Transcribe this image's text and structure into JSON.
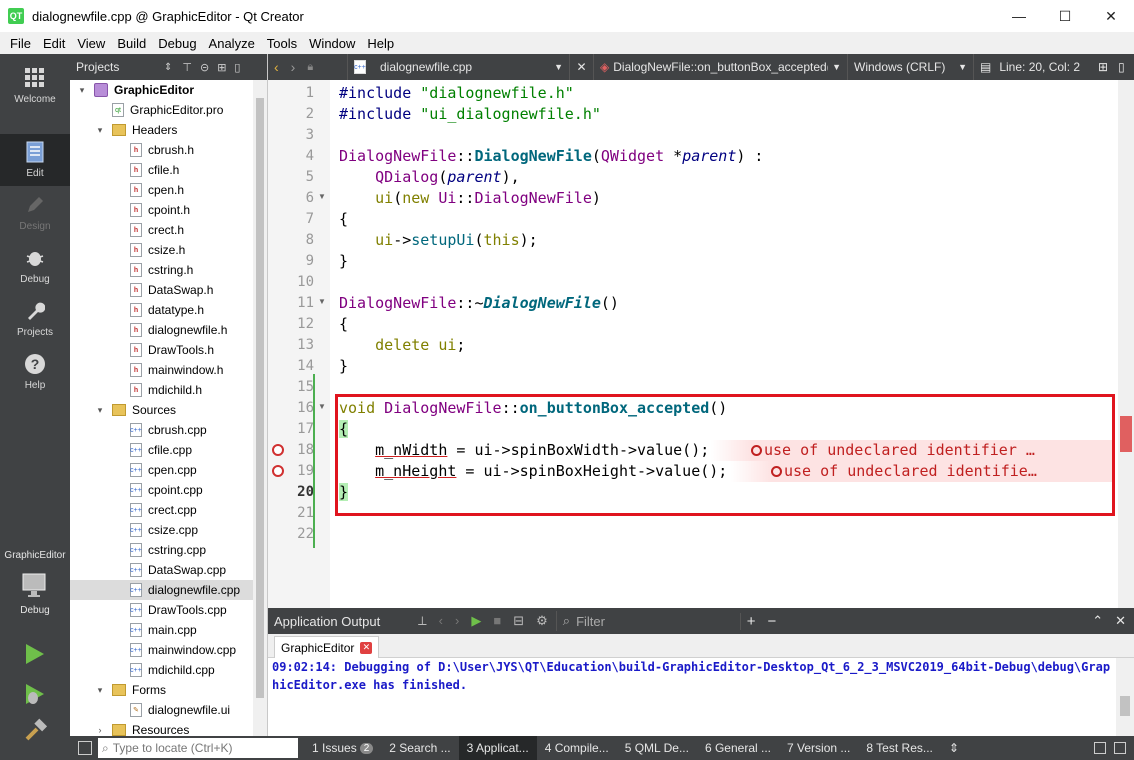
{
  "window": {
    "title": "dialognewfile.cpp @ GraphicEditor - Qt Creator",
    "app_icon": "QT",
    "minimize": "—",
    "maximize": "☐",
    "close": "✕"
  },
  "menu": [
    "File",
    "Edit",
    "View",
    "Build",
    "Debug",
    "Analyze",
    "Tools",
    "Window",
    "Help"
  ],
  "modes": {
    "welcome": "Welcome",
    "edit": "Edit",
    "design": "Design",
    "debug": "Debug",
    "projects": "Projects",
    "help": "Help",
    "kit_name": "GraphicEditor",
    "kit_mode": "Debug"
  },
  "projects": {
    "header": "Projects",
    "tree": [
      {
        "label": "GraphicEditor",
        "kind": "project",
        "depth": 0,
        "arrow": "▾"
      },
      {
        "label": "GraphicEditor.pro",
        "kind": "pro",
        "depth": 1
      },
      {
        "label": "Headers",
        "kind": "folder",
        "depth": 1,
        "arrow": "▾"
      },
      {
        "label": "cbrush.h",
        "kind": "h",
        "depth": 2
      },
      {
        "label": "cfile.h",
        "kind": "h",
        "depth": 2
      },
      {
        "label": "cpen.h",
        "kind": "h",
        "depth": 2
      },
      {
        "label": "cpoint.h",
        "kind": "h",
        "depth": 2
      },
      {
        "label": "crect.h",
        "kind": "h",
        "depth": 2
      },
      {
        "label": "csize.h",
        "kind": "h",
        "depth": 2
      },
      {
        "label": "cstring.h",
        "kind": "h",
        "depth": 2
      },
      {
        "label": "DataSwap.h",
        "kind": "h",
        "depth": 2
      },
      {
        "label": "datatype.h",
        "kind": "h",
        "depth": 2
      },
      {
        "label": "dialognewfile.h",
        "kind": "h",
        "depth": 2
      },
      {
        "label": "DrawTools.h",
        "kind": "h",
        "depth": 2
      },
      {
        "label": "mainwindow.h",
        "kind": "h",
        "depth": 2
      },
      {
        "label": "mdichild.h",
        "kind": "h",
        "depth": 2
      },
      {
        "label": "Sources",
        "kind": "folder",
        "depth": 1,
        "arrow": "▾"
      },
      {
        "label": "cbrush.cpp",
        "kind": "cpp",
        "depth": 2
      },
      {
        "label": "cfile.cpp",
        "kind": "cpp",
        "depth": 2
      },
      {
        "label": "cpen.cpp",
        "kind": "cpp",
        "depth": 2
      },
      {
        "label": "cpoint.cpp",
        "kind": "cpp",
        "depth": 2
      },
      {
        "label": "crect.cpp",
        "kind": "cpp",
        "depth": 2
      },
      {
        "label": "csize.cpp",
        "kind": "cpp",
        "depth": 2
      },
      {
        "label": "cstring.cpp",
        "kind": "cpp",
        "depth": 2
      },
      {
        "label": "DataSwap.cpp",
        "kind": "cpp",
        "depth": 2
      },
      {
        "label": "dialognewfile.cpp",
        "kind": "cpp",
        "depth": 2,
        "selected": true
      },
      {
        "label": "DrawTools.cpp",
        "kind": "cpp",
        "depth": 2
      },
      {
        "label": "main.cpp",
        "kind": "cpp",
        "depth": 2
      },
      {
        "label": "mainwindow.cpp",
        "kind": "cpp",
        "depth": 2
      },
      {
        "label": "mdichild.cpp",
        "kind": "cpp",
        "depth": 2
      },
      {
        "label": "Forms",
        "kind": "folder",
        "depth": 1,
        "arrow": "▾"
      },
      {
        "label": "dialognewfile.ui",
        "kind": "ui",
        "depth": 2
      },
      {
        "label": "Resources",
        "kind": "folder",
        "depth": 1,
        "arrow": "›"
      }
    ]
  },
  "editor_toolbar": {
    "file": "dialognewfile.cpp",
    "symbol": "DialogNewFile::on_buttonBox_accepted()...",
    "line_ending": "Windows (CRLF)",
    "position": "Line: 20, Col: 2"
  },
  "code": {
    "current_line": 20,
    "lines": [
      {
        "n": "1"
      },
      {
        "n": "2"
      },
      {
        "n": "3"
      },
      {
        "n": "4"
      },
      {
        "n": "5"
      },
      {
        "n": "6"
      },
      {
        "n": "7"
      },
      {
        "n": "8"
      },
      {
        "n": "9"
      },
      {
        "n": "10"
      },
      {
        "n": "11"
      },
      {
        "n": "12"
      },
      {
        "n": "13"
      },
      {
        "n": "14"
      },
      {
        "n": "15"
      },
      {
        "n": "16"
      },
      {
        "n": "17"
      },
      {
        "n": "18"
      },
      {
        "n": "19"
      },
      {
        "n": "20"
      },
      {
        "n": "21"
      },
      {
        "n": "22"
      }
    ],
    "t": {
      "include": "#include",
      "inc1": "\"dialognewfile.h\"",
      "inc2": "\"ui_dialognewfile.h\"",
      "cls": "DialogNewFile",
      "sep": "::",
      "ctor": "DialogNewFile",
      "qwidget": "QWidget",
      "param_ptr": " *",
      "parent": "parent",
      "colon": " :",
      "qdialog": "QDialog",
      "ui": "ui",
      "new_kw": "new",
      "ui_ns": "Ui",
      "ui_cls": "DialogNewFile",
      "setupui": "setupUi",
      "this_kw": "this",
      "tilde": "~",
      "dtor": "DialogNewFile",
      "delete_kw": "delete",
      "void_kw": "void",
      "slot": "on_buttonBox_accepted",
      "mw": "m_nWidth",
      "mh": "m_nHeight",
      "rest18": " = ui->spinBoxWidth->value();",
      "rest19": " = ui->spinBoxHeight->value();",
      "err18": "use of undeclared identifier …",
      "err19": "use of undeclared identifie…"
    }
  },
  "output": {
    "title": "Application Output",
    "filter_placeholder": "Filter",
    "tab": "GraphicEditor",
    "text": "09:02:14: Debugging of D:\\User\\JYS\\QT\\Education\\build-GraphicEditor-Desktop_Qt_6_2_3_MSVC2019_64bit-Debug\\debug\\GraphicEditor.exe has finished."
  },
  "statusbar": {
    "locate_placeholder": "Type to locate (Ctrl+K)",
    "tabs": [
      "1 Issues",
      "2 Search ...",
      "3 Applicat...",
      "4 Compile...",
      "5 QML De...",
      "6 General ...",
      "7 Version ...",
      "8 Test Res..."
    ],
    "issues_count": "2"
  },
  "colors": {
    "dark_panel": "#404244",
    "highlight_box": "#e0141e",
    "error_text": "#c02020",
    "output_text": "#1a1ac8",
    "change_bar": "#4caf50"
  }
}
